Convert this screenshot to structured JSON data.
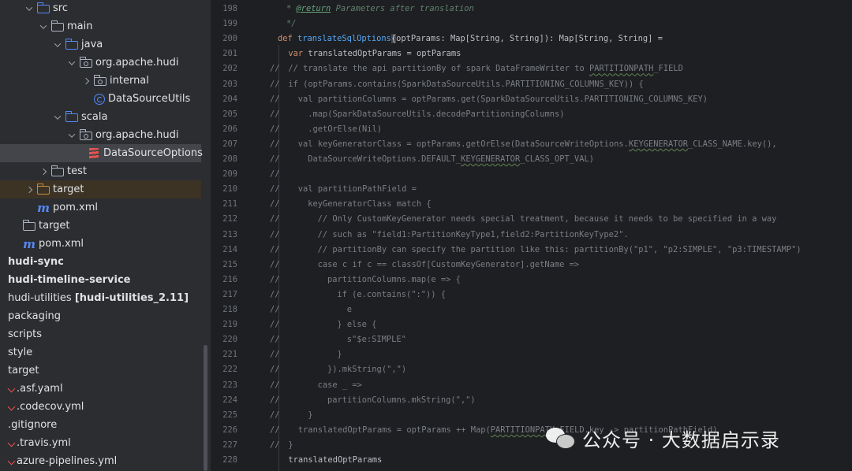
{
  "project_tree": {
    "rows": [
      {
        "label": "src",
        "indent": 1,
        "chevron": "down",
        "icon": "folder-source-icon",
        "style": "normal"
      },
      {
        "label": "main",
        "indent": 2,
        "chevron": "down",
        "icon": "folder-icon",
        "style": "normal"
      },
      {
        "label": "java",
        "indent": 3,
        "chevron": "down",
        "icon": "folder-source-icon",
        "style": "normal"
      },
      {
        "label": "org.apache.hudi",
        "indent": 4,
        "chevron": "down",
        "icon": "package-icon",
        "style": "normal"
      },
      {
        "label": "internal",
        "indent": 5,
        "chevron": "right",
        "icon": "package-icon",
        "style": "normal"
      },
      {
        "label": "DataSourceUtils",
        "indent": 5,
        "chevron": "none",
        "icon": "java-class-icon",
        "style": "normal"
      },
      {
        "label": "scala",
        "indent": 3,
        "chevron": "down",
        "icon": "folder-source-icon",
        "style": "normal"
      },
      {
        "label": "org.apache.hudi",
        "indent": 4,
        "chevron": "down",
        "icon": "package-icon",
        "style": "normal"
      },
      {
        "label": "DataSourceOptions",
        "indent": 5,
        "chevron": "none",
        "icon": "scala-file-icon",
        "style": "selected"
      },
      {
        "label": "test",
        "indent": 2,
        "chevron": "right",
        "icon": "folder-icon",
        "style": "normal"
      },
      {
        "label": "target",
        "indent": 1,
        "chevron": "right",
        "icon": "folder-excluded-icon",
        "style": "highlight"
      },
      {
        "label": "pom.xml",
        "indent": 1,
        "chevron": "none",
        "icon": "maven-icon",
        "style": "normal"
      },
      {
        "label": "target",
        "indent": 0,
        "chevron": "none",
        "icon": "folder-icon",
        "style": "normal"
      },
      {
        "label": "pom.xml",
        "indent": 0,
        "chevron": "none",
        "icon": "maven-icon",
        "style": "normal"
      },
      {
        "label": "hudi-sync",
        "indent": -1,
        "chevron": "none",
        "icon": "none",
        "style": "bold"
      },
      {
        "label": "hudi-timeline-service",
        "indent": -1,
        "chevron": "none",
        "icon": "none",
        "style": "bold"
      },
      {
        "label": "hudi-utilities [hudi-utilities_2.11]",
        "indent": -1,
        "chevron": "none",
        "icon": "none",
        "style": "mixed",
        "bold_suffix": "[hudi-utilities_2.11]"
      },
      {
        "label": "packaging",
        "indent": -1,
        "chevron": "none",
        "icon": "none",
        "style": "normal"
      },
      {
        "label": "scripts",
        "indent": -1,
        "chevron": "none",
        "icon": "none",
        "style": "normal"
      },
      {
        "label": "style",
        "indent": -1,
        "chevron": "none",
        "icon": "none",
        "style": "normal"
      },
      {
        "label": "target",
        "indent": -1,
        "chevron": "none",
        "icon": "none",
        "style": "normal"
      },
      {
        "label": ".asf.yaml",
        "indent": -1,
        "chevron": "none",
        "icon": "yaml-icon",
        "style": "normal"
      },
      {
        "label": ".codecov.yml",
        "indent": -1,
        "chevron": "none",
        "icon": "yaml-icon",
        "style": "normal"
      },
      {
        "label": ".gitignore",
        "indent": -1,
        "chevron": "none",
        "icon": "none",
        "style": "normal"
      },
      {
        "label": ".travis.yml",
        "indent": -1,
        "chevron": "none",
        "icon": "yaml-icon",
        "style": "normal"
      },
      {
        "label": "azure-pipelines.yml",
        "indent": -1,
        "chevron": "none",
        "icon": "yaml-icon",
        "style": "normal"
      }
    ]
  },
  "editor": {
    "lines": [
      {
        "num": "198",
        "commented": false,
        "indent": 1,
        "tokens": [
          [
            "doc",
            "* "
          ],
          [
            "doctag",
            "@return"
          ],
          [
            "doc",
            " Parameters after translation"
          ]
        ]
      },
      {
        "num": "199",
        "commented": false,
        "indent": 1,
        "tokens": [
          [
            "doc",
            "*/"
          ]
        ]
      },
      {
        "num": "200",
        "commented": false,
        "indent": 0,
        "tokens": [
          [
            "kw",
            "def "
          ],
          [
            "fn",
            "translateSqlOptions"
          ],
          [
            "code",
            "(optParams: Map[String, String]): Map[String, String] = "
          ],
          [
            "brace",
            "{"
          ]
        ]
      },
      {
        "num": "201",
        "commented": false,
        "indent": 1,
        "tokens": [
          [
            "kw",
            "var "
          ],
          [
            "code",
            "translatedOptParams = optParams"
          ]
        ]
      },
      {
        "num": "202",
        "commented": true,
        "indent": 1,
        "tokens": [
          [
            "cmt",
            "// translate the api partitionBy of spark DataFrameWriter to "
          ],
          [
            "cmtu",
            "PARTITIONPATH"
          ],
          [
            "cmt",
            "_FIELD"
          ]
        ]
      },
      {
        "num": "203",
        "commented": true,
        "indent": 1,
        "tokens": [
          [
            "cmt",
            "if (optParams.contains(SparkDataSourceUtils.PARTITIONING_COLUMNS_KEY)) {"
          ]
        ]
      },
      {
        "num": "204",
        "commented": true,
        "indent": 2,
        "tokens": [
          [
            "cmt",
            "val partitionColumns = optParams.get(SparkDataSourceUtils.PARTITIONING_COLUMNS_KEY)"
          ]
        ]
      },
      {
        "num": "205",
        "commented": true,
        "indent": 3,
        "tokens": [
          [
            "cmt",
            ".map(SparkDataSourceUtils.decodePartitioningColumns)"
          ]
        ]
      },
      {
        "num": "206",
        "commented": true,
        "indent": 3,
        "tokens": [
          [
            "cmt",
            ".getOrElse(Nil)"
          ]
        ]
      },
      {
        "num": "207",
        "commented": true,
        "indent": 2,
        "tokens": [
          [
            "cmt",
            "val keyGeneratorClass = optParams.getOrElse(DataSourceWriteOptions."
          ],
          [
            "cmtu",
            "KEYGENERATOR"
          ],
          [
            "cmt",
            "_CLASS_NAME.key(),"
          ]
        ]
      },
      {
        "num": "208",
        "commented": true,
        "indent": 3,
        "tokens": [
          [
            "cmt",
            "DataSourceWriteOptions.DEFAULT_"
          ],
          [
            "cmtu",
            "KEYGENERATOR"
          ],
          [
            "cmt",
            "_CLASS_OPT_VAL)"
          ]
        ]
      },
      {
        "num": "209",
        "commented": true,
        "indent": 0,
        "tokens": []
      },
      {
        "num": "210",
        "commented": true,
        "indent": 2,
        "tokens": [
          [
            "cmt",
            "val partitionPathField ="
          ]
        ]
      },
      {
        "num": "211",
        "commented": true,
        "indent": 3,
        "tokens": [
          [
            "cmt",
            "keyGeneratorClass match {"
          ]
        ]
      },
      {
        "num": "212",
        "commented": true,
        "indent": 4,
        "tokens": [
          [
            "cmt",
            "// Only CustomKeyGenerator needs special treatment, because it needs to be specified in a way"
          ]
        ]
      },
      {
        "num": "213",
        "commented": true,
        "indent": 4,
        "tokens": [
          [
            "cmt",
            "// such as \"field1:PartitionKeyType1,field2:PartitionKeyType2\"."
          ]
        ]
      },
      {
        "num": "214",
        "commented": true,
        "indent": 4,
        "tokens": [
          [
            "cmt",
            "// partitionBy can specify the partition like this: partitionBy(\"p1\", \"p2:SIMPLE\", \"p3:TIMESTAMP\")"
          ]
        ]
      },
      {
        "num": "215",
        "commented": true,
        "indent": 4,
        "tokens": [
          [
            "cmt",
            "case c if c == classOf[CustomKeyGenerator].getName =>"
          ]
        ]
      },
      {
        "num": "216",
        "commented": true,
        "indent": 5,
        "tokens": [
          [
            "cmt",
            "partitionColumns.map(e => {"
          ]
        ]
      },
      {
        "num": "217",
        "commented": true,
        "indent": 6,
        "tokens": [
          [
            "cmt",
            "if (e.contains(\":\")) {"
          ]
        ]
      },
      {
        "num": "218",
        "commented": true,
        "indent": 7,
        "tokens": [
          [
            "cmt",
            "e"
          ]
        ]
      },
      {
        "num": "219",
        "commented": true,
        "indent": 6,
        "tokens": [
          [
            "cmt",
            "} else {"
          ]
        ]
      },
      {
        "num": "220",
        "commented": true,
        "indent": 7,
        "tokens": [
          [
            "cmt",
            "s\"$e:SIMPLE\""
          ]
        ]
      },
      {
        "num": "221",
        "commented": true,
        "indent": 6,
        "tokens": [
          [
            "cmt",
            "}"
          ]
        ]
      },
      {
        "num": "222",
        "commented": true,
        "indent": 5,
        "tokens": [
          [
            "cmt",
            "}).mkString(\",\")"
          ]
        ]
      },
      {
        "num": "223",
        "commented": true,
        "indent": 4,
        "tokens": [
          [
            "cmt",
            "case _ =>"
          ]
        ]
      },
      {
        "num": "224",
        "commented": true,
        "indent": 5,
        "tokens": [
          [
            "cmt",
            "partitionColumns.mkString(\",\")"
          ]
        ]
      },
      {
        "num": "225",
        "commented": true,
        "indent": 3,
        "tokens": [
          [
            "cmt",
            "}"
          ]
        ]
      },
      {
        "num": "226",
        "commented": true,
        "indent": 2,
        "tokens": [
          [
            "cmt",
            "translatedOptParams = optParams ++ Map("
          ],
          [
            "cmtu",
            "PARTITIONPATH"
          ],
          [
            "cmt",
            "_FIELD.key -> partitionPathField)"
          ]
        ]
      },
      {
        "num": "227",
        "commented": true,
        "indent": 1,
        "tokens": [
          [
            "cmt",
            "}"
          ]
        ]
      },
      {
        "num": "228",
        "commented": false,
        "indent": 1,
        "tokens": [
          [
            "code",
            "translatedOptParams"
          ]
        ]
      }
    ]
  },
  "watermark": {
    "text": "公众号 · 大数据启示录",
    "icon": "wechat-icon"
  }
}
